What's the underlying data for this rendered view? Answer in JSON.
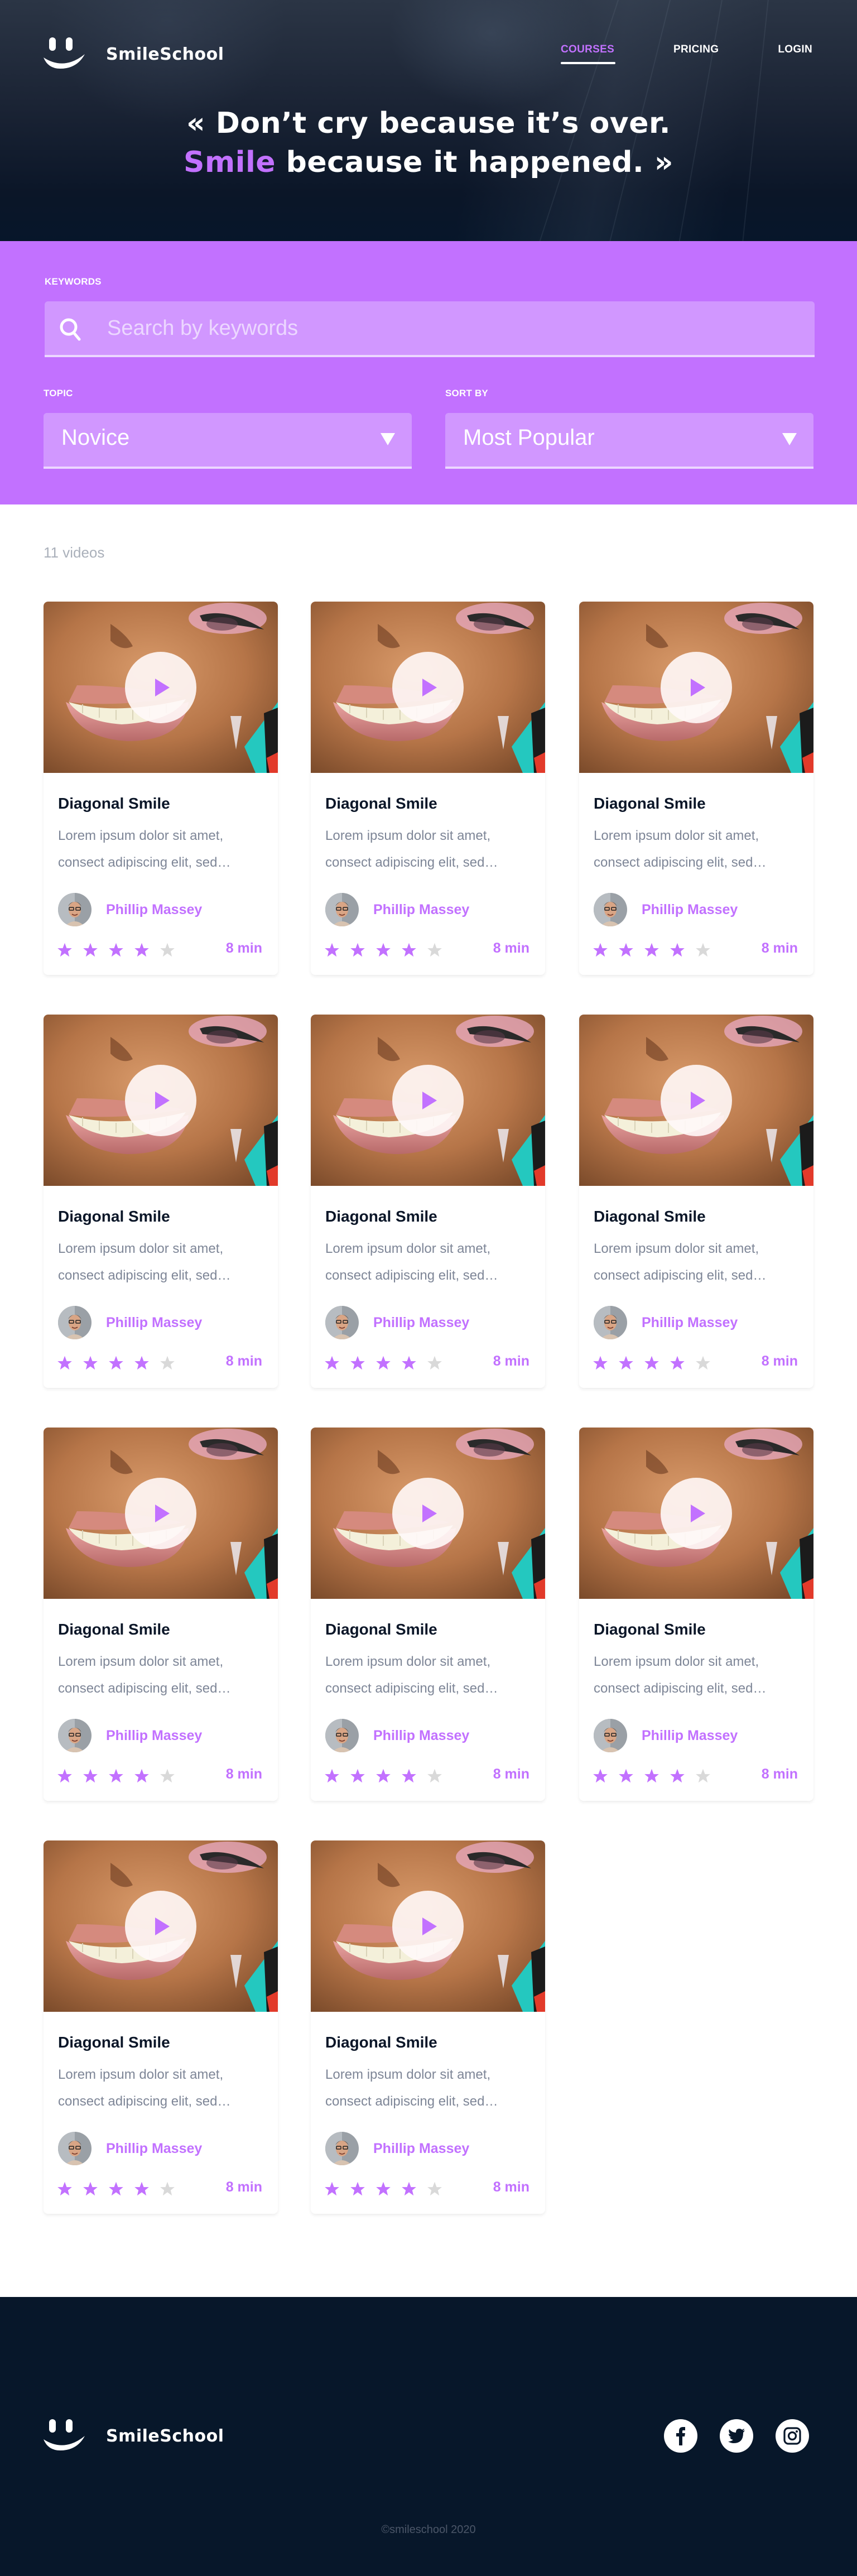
{
  "brand": {
    "name": "SmileSchool"
  },
  "nav": {
    "items": [
      {
        "label": "COURSES",
        "active": true
      },
      {
        "label": "PRICING",
        "active": false
      },
      {
        "label": "LOGIN",
        "active": false
      }
    ]
  },
  "hero": {
    "quote_open": "« Don’t cry because it’s over.",
    "quote_accent": "Smile",
    "quote_rest": " because it happened. »"
  },
  "filters": {
    "keywords_label": "KEYWORDS",
    "search_placeholder": "Search by keywords",
    "search_value": "",
    "topic_label": "TOPIC",
    "topic_value": "Novice",
    "sort_label": "SORT BY",
    "sort_value": "Most Popular"
  },
  "results": {
    "count_label": "11 videos",
    "videos": [
      {
        "title": "Diagonal Smile",
        "description": "Lorem ipsum dolor sit amet, consect adipiscing elit, sed…",
        "author": "Phillip Massey",
        "rating": 4,
        "max_rating": 5,
        "duration": "8 min"
      },
      {
        "title": "Diagonal Smile",
        "description": "Lorem ipsum dolor sit amet, consect adipiscing elit, sed…",
        "author": "Phillip Massey",
        "rating": 4,
        "max_rating": 5,
        "duration": "8 min"
      },
      {
        "title": "Diagonal Smile",
        "description": "Lorem ipsum dolor sit amet, consect adipiscing elit, sed…",
        "author": "Phillip Massey",
        "rating": 4,
        "max_rating": 5,
        "duration": "8 min"
      },
      {
        "title": "Diagonal Smile",
        "description": "Lorem ipsum dolor sit amet, consect adipiscing elit, sed…",
        "author": "Phillip Massey",
        "rating": 4,
        "max_rating": 5,
        "duration": "8 min"
      },
      {
        "title": "Diagonal Smile",
        "description": "Lorem ipsum dolor sit amet, consect adipiscing elit, sed…",
        "author": "Phillip Massey",
        "rating": 4,
        "max_rating": 5,
        "duration": "8 min"
      },
      {
        "title": "Diagonal Smile",
        "description": "Lorem ipsum dolor sit amet, consect adipiscing elit, sed…",
        "author": "Phillip Massey",
        "rating": 4,
        "max_rating": 5,
        "duration": "8 min"
      },
      {
        "title": "Diagonal Smile",
        "description": "Lorem ipsum dolor sit amet, consect adipiscing elit, sed…",
        "author": "Phillip Massey",
        "rating": 4,
        "max_rating": 5,
        "duration": "8 min"
      },
      {
        "title": "Diagonal Smile",
        "description": "Lorem ipsum dolor sit amet, consect adipiscing elit, sed…",
        "author": "Phillip Massey",
        "rating": 4,
        "max_rating": 5,
        "duration": "8 min"
      },
      {
        "title": "Diagonal Smile",
        "description": "Lorem ipsum dolor sit amet, consect adipiscing elit, sed…",
        "author": "Phillip Massey",
        "rating": 4,
        "max_rating": 5,
        "duration": "8 min"
      },
      {
        "title": "Diagonal Smile",
        "description": "Lorem ipsum dolor sit amet, consect adipiscing elit, sed…",
        "author": "Phillip Massey",
        "rating": 4,
        "max_rating": 5,
        "duration": "8 min"
      },
      {
        "title": "Diagonal Smile",
        "description": "Lorem ipsum dolor sit amet, consect adipiscing elit, sed…",
        "author": "Phillip Massey",
        "rating": 4,
        "max_rating": 5,
        "duration": "8 min"
      }
    ]
  },
  "footer": {
    "social": [
      {
        "name": "facebook",
        "icon": "facebook-icon"
      },
      {
        "name": "twitter",
        "icon": "twitter-icon"
      },
      {
        "name": "instagram",
        "icon": "instagram-icon"
      }
    ],
    "copyright": "©smileschool 2020"
  },
  "colors": {
    "accent": "#c271ff",
    "accent_light": "#d197ff",
    "dark": "#07172a",
    "star_empty": "#d9d9d9",
    "muted_text": "#7e8697"
  }
}
